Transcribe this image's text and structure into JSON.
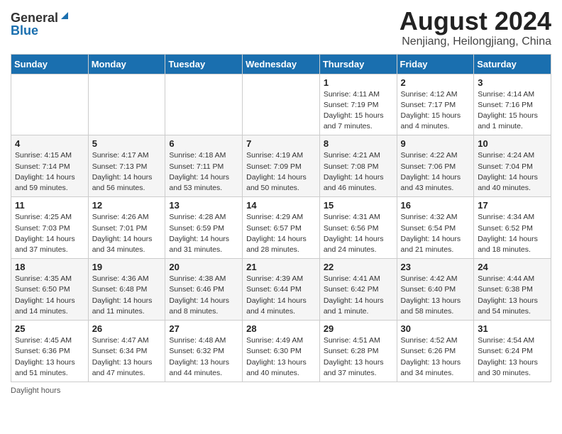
{
  "header": {
    "logo_general": "General",
    "logo_blue": "Blue",
    "month_year": "August 2024",
    "location": "Nenjiang, Heilongjiang, China"
  },
  "days_of_week": [
    "Sunday",
    "Monday",
    "Tuesday",
    "Wednesday",
    "Thursday",
    "Friday",
    "Saturday"
  ],
  "weeks": [
    [
      {
        "day": "",
        "info": ""
      },
      {
        "day": "",
        "info": ""
      },
      {
        "day": "",
        "info": ""
      },
      {
        "day": "",
        "info": ""
      },
      {
        "day": "1",
        "info": "Sunrise: 4:11 AM\nSunset: 7:19 PM\nDaylight: 15 hours\nand 7 minutes."
      },
      {
        "day": "2",
        "info": "Sunrise: 4:12 AM\nSunset: 7:17 PM\nDaylight: 15 hours\nand 4 minutes."
      },
      {
        "day": "3",
        "info": "Sunrise: 4:14 AM\nSunset: 7:16 PM\nDaylight: 15 hours\nand 1 minute."
      }
    ],
    [
      {
        "day": "4",
        "info": "Sunrise: 4:15 AM\nSunset: 7:14 PM\nDaylight: 14 hours\nand 59 minutes."
      },
      {
        "day": "5",
        "info": "Sunrise: 4:17 AM\nSunset: 7:13 PM\nDaylight: 14 hours\nand 56 minutes."
      },
      {
        "day": "6",
        "info": "Sunrise: 4:18 AM\nSunset: 7:11 PM\nDaylight: 14 hours\nand 53 minutes."
      },
      {
        "day": "7",
        "info": "Sunrise: 4:19 AM\nSunset: 7:09 PM\nDaylight: 14 hours\nand 50 minutes."
      },
      {
        "day": "8",
        "info": "Sunrise: 4:21 AM\nSunset: 7:08 PM\nDaylight: 14 hours\nand 46 minutes."
      },
      {
        "day": "9",
        "info": "Sunrise: 4:22 AM\nSunset: 7:06 PM\nDaylight: 14 hours\nand 43 minutes."
      },
      {
        "day": "10",
        "info": "Sunrise: 4:24 AM\nSunset: 7:04 PM\nDaylight: 14 hours\nand 40 minutes."
      }
    ],
    [
      {
        "day": "11",
        "info": "Sunrise: 4:25 AM\nSunset: 7:03 PM\nDaylight: 14 hours\nand 37 minutes."
      },
      {
        "day": "12",
        "info": "Sunrise: 4:26 AM\nSunset: 7:01 PM\nDaylight: 14 hours\nand 34 minutes."
      },
      {
        "day": "13",
        "info": "Sunrise: 4:28 AM\nSunset: 6:59 PM\nDaylight: 14 hours\nand 31 minutes."
      },
      {
        "day": "14",
        "info": "Sunrise: 4:29 AM\nSunset: 6:57 PM\nDaylight: 14 hours\nand 28 minutes."
      },
      {
        "day": "15",
        "info": "Sunrise: 4:31 AM\nSunset: 6:56 PM\nDaylight: 14 hours\nand 24 minutes."
      },
      {
        "day": "16",
        "info": "Sunrise: 4:32 AM\nSunset: 6:54 PM\nDaylight: 14 hours\nand 21 minutes."
      },
      {
        "day": "17",
        "info": "Sunrise: 4:34 AM\nSunset: 6:52 PM\nDaylight: 14 hours\nand 18 minutes."
      }
    ],
    [
      {
        "day": "18",
        "info": "Sunrise: 4:35 AM\nSunset: 6:50 PM\nDaylight: 14 hours\nand 14 minutes."
      },
      {
        "day": "19",
        "info": "Sunrise: 4:36 AM\nSunset: 6:48 PM\nDaylight: 14 hours\nand 11 minutes."
      },
      {
        "day": "20",
        "info": "Sunrise: 4:38 AM\nSunset: 6:46 PM\nDaylight: 14 hours\nand 8 minutes."
      },
      {
        "day": "21",
        "info": "Sunrise: 4:39 AM\nSunset: 6:44 PM\nDaylight: 14 hours\nand 4 minutes."
      },
      {
        "day": "22",
        "info": "Sunrise: 4:41 AM\nSunset: 6:42 PM\nDaylight: 14 hours\nand 1 minute."
      },
      {
        "day": "23",
        "info": "Sunrise: 4:42 AM\nSunset: 6:40 PM\nDaylight: 13 hours\nand 58 minutes."
      },
      {
        "day": "24",
        "info": "Sunrise: 4:44 AM\nSunset: 6:38 PM\nDaylight: 13 hours\nand 54 minutes."
      }
    ],
    [
      {
        "day": "25",
        "info": "Sunrise: 4:45 AM\nSunset: 6:36 PM\nDaylight: 13 hours\nand 51 minutes."
      },
      {
        "day": "26",
        "info": "Sunrise: 4:47 AM\nSunset: 6:34 PM\nDaylight: 13 hours\nand 47 minutes."
      },
      {
        "day": "27",
        "info": "Sunrise: 4:48 AM\nSunset: 6:32 PM\nDaylight: 13 hours\nand 44 minutes."
      },
      {
        "day": "28",
        "info": "Sunrise: 4:49 AM\nSunset: 6:30 PM\nDaylight: 13 hours\nand 40 minutes."
      },
      {
        "day": "29",
        "info": "Sunrise: 4:51 AM\nSunset: 6:28 PM\nDaylight: 13 hours\nand 37 minutes."
      },
      {
        "day": "30",
        "info": "Sunrise: 4:52 AM\nSunset: 6:26 PM\nDaylight: 13 hours\nand 34 minutes."
      },
      {
        "day": "31",
        "info": "Sunrise: 4:54 AM\nSunset: 6:24 PM\nDaylight: 13 hours\nand 30 minutes."
      }
    ]
  ],
  "footer": {
    "daylight_hours": "Daylight hours"
  }
}
